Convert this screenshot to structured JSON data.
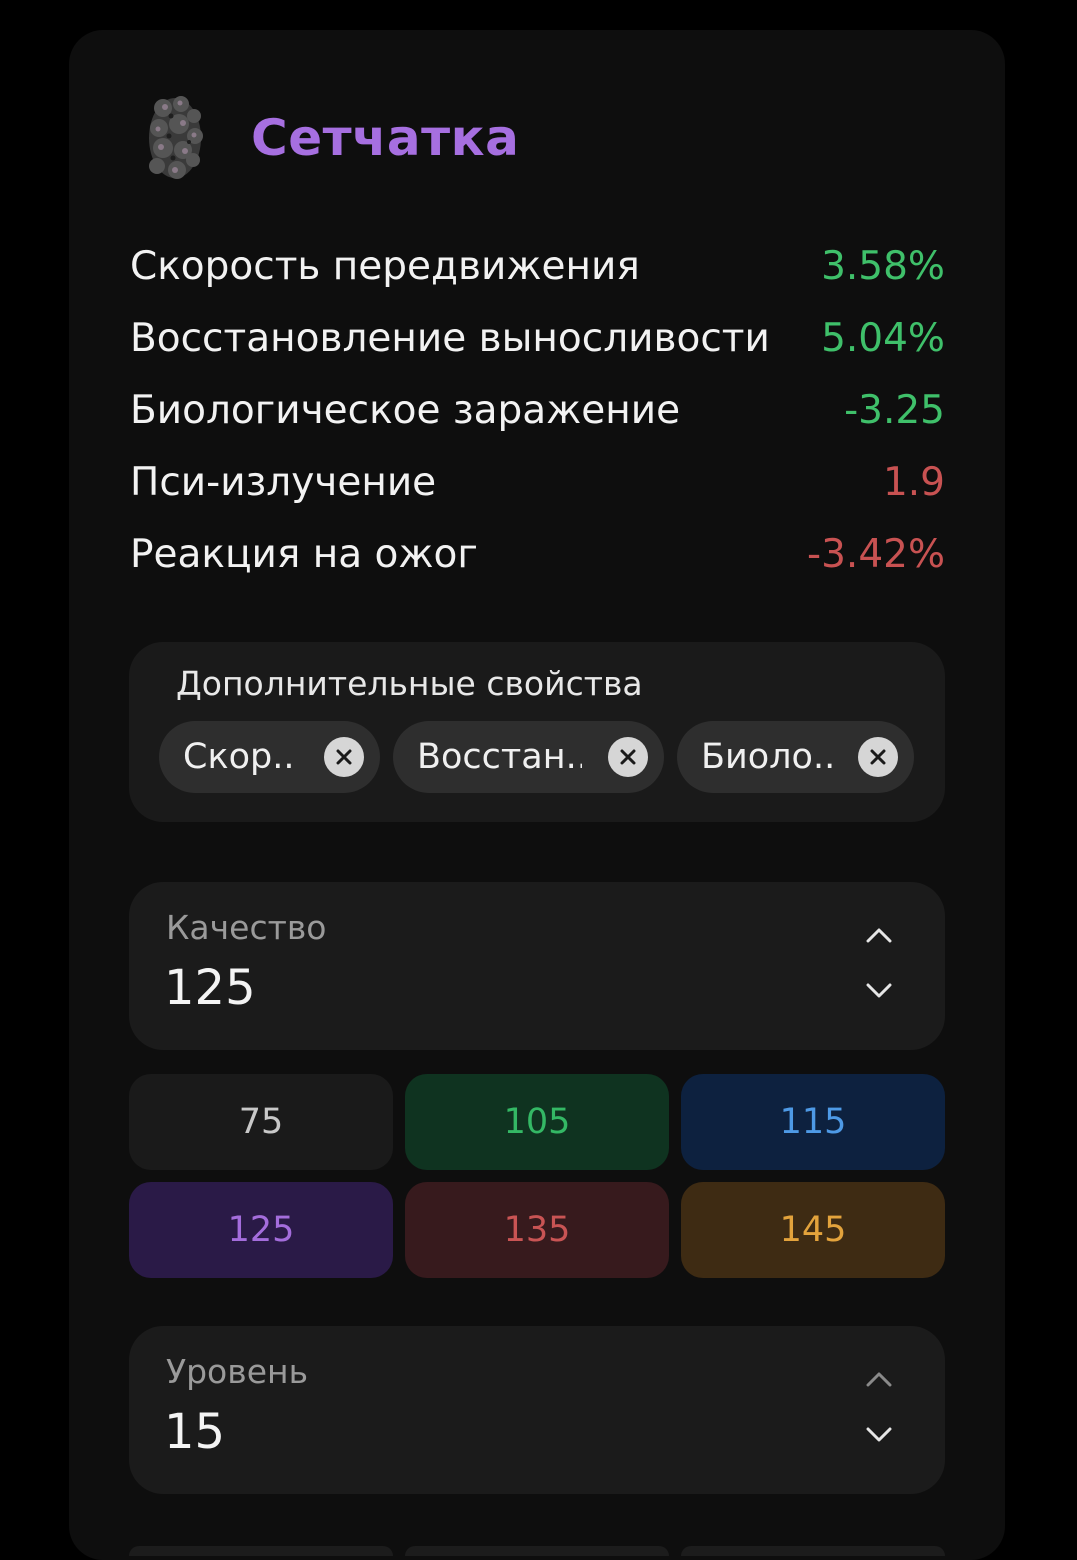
{
  "header": {
    "title": "Сетчатка",
    "icon": "artifact-icon"
  },
  "stats": [
    {
      "label": "Скорость передвижения",
      "value": "3.58%",
      "color": "#3fc06a"
    },
    {
      "label": "Восстановление выносливости",
      "value": "5.04%",
      "color": "#3fc06a"
    },
    {
      "label": "Биологическое заражение",
      "value": "-3.25",
      "color": "#3fc06a"
    },
    {
      "label": "Пси-излучение",
      "value": "1.9",
      "color": "#c85252"
    },
    {
      "label": "Реакция на ожог",
      "value": "-3.42%",
      "color": "#c85252"
    }
  ],
  "extra": {
    "title": "Дополнительные свойства",
    "chips": [
      {
        "label": "Скор..."
      },
      {
        "label": "Восстан..."
      },
      {
        "label": "Биоло..."
      }
    ]
  },
  "quality": {
    "label": "Качество",
    "value": "125",
    "options": [
      {
        "label": "75",
        "text": "#c8c8c8",
        "bg": "#1a1a1a"
      },
      {
        "label": "105",
        "text": "#34b865",
        "bg": "#0f3320"
      },
      {
        "label": "115",
        "text": "#4e9ae6",
        "bg": "#0d213f"
      },
      {
        "label": "125",
        "text": "#a46ddc",
        "bg": "#2a1a47"
      },
      {
        "label": "135",
        "text": "#c95454",
        "bg": "#371a1d"
      },
      {
        "label": "145",
        "text": "#e3a33c",
        "bg": "#3e2b13"
      }
    ]
  },
  "level": {
    "label": "Уровень",
    "value": "15"
  }
}
